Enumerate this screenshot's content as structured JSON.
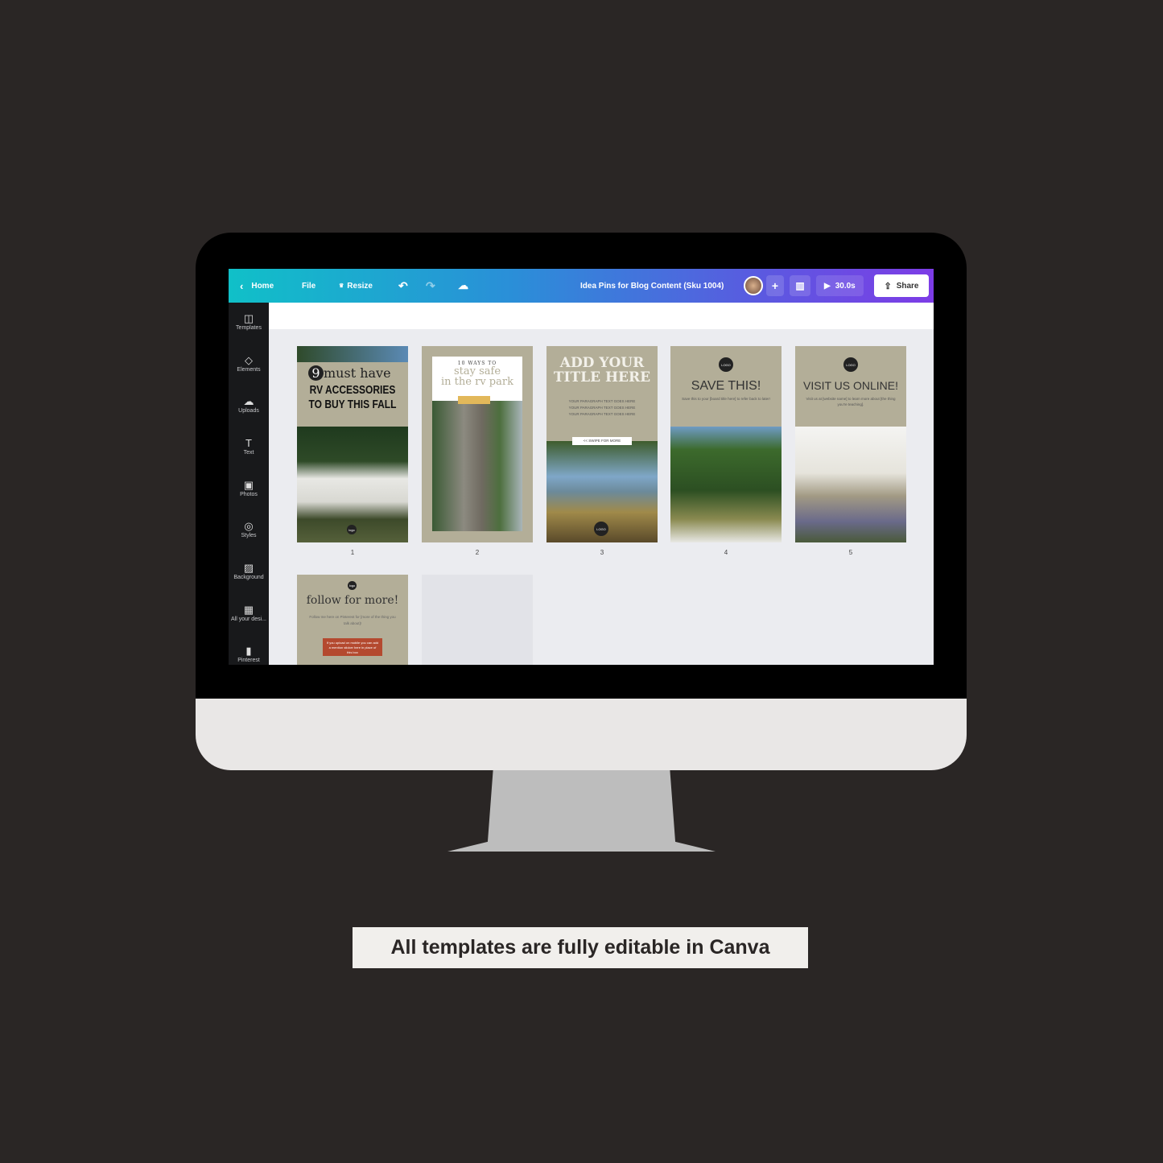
{
  "topbar": {
    "home": "Home",
    "file": "File",
    "resize": "Resize",
    "title": "Idea Pins for Blog Content (Sku 1004)",
    "play_time": "30.0s",
    "share": "Share"
  },
  "sidebar": {
    "items": [
      {
        "label": "Templates",
        "icon": "templates-icon"
      },
      {
        "label": "Elements",
        "icon": "elements-icon"
      },
      {
        "label": "Uploads",
        "icon": "upload-cloud-icon"
      },
      {
        "label": "Text",
        "icon": "text-icon"
      },
      {
        "label": "Photos",
        "icon": "photo-icon"
      },
      {
        "label": "Styles",
        "icon": "palette-icon"
      },
      {
        "label": "Background",
        "icon": "background-icon"
      },
      {
        "label": "All your desi...",
        "icon": "grid-icon"
      },
      {
        "label": "Pinterest",
        "icon": "pinterest-folder-icon"
      }
    ]
  },
  "pages": [
    {
      "number": "1",
      "num_badge": "9",
      "title": "must have",
      "subtitle": "RV ACCESSORIES",
      "subtitle2": "TO BUY THIS FALL",
      "logo": "logo"
    },
    {
      "number": "2",
      "kicker": "10 WAYS TO",
      "title": "stay safe",
      "title2": "in the rv park"
    },
    {
      "number": "3",
      "title": "ADD YOUR",
      "title2": "TITLE HERE",
      "para": "YOUR PARAGRAPH TEXT GOES HERE",
      "para2": "YOUR PARAGRAPH TEXT GOES HERE",
      "para3": "YOUR PARAGRAPH TEXT GOES HERE",
      "swipe": "<< SWIPE FOR MORE",
      "logo": "LOGO"
    },
    {
      "number": "4",
      "logo": "LOGO",
      "title": "SAVE THIS!",
      "body": "Save this to your [board title here] to refer back to later!"
    },
    {
      "number": "5",
      "logo": "LOGO",
      "title": "VISIT US ONLINE!",
      "body": "Visit us at [website name] to learn more about [the thing you're teaching]."
    },
    {
      "logo": "logo",
      "title": "follow for more!",
      "body": "Follow me here on Pinterest for [more of the thing you talk about]!",
      "box": "If you upload on mobile you can add a mention sticker here in place of this box"
    }
  ],
  "caption": "All templates are fully editable in Canva",
  "colors": {
    "background": "#2a2625",
    "page_bg": "#b3ae98",
    "box": "#b4492f"
  }
}
